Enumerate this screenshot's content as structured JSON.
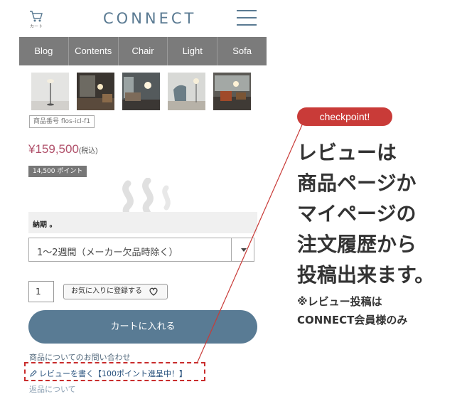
{
  "header": {
    "cart_label": "カート",
    "logo": "CONNECT",
    "cart_icon": "cart-icon",
    "menu_icon": "hamburger-menu-icon"
  },
  "nav": {
    "items": [
      {
        "label": "Blog"
      },
      {
        "label": "Contents"
      },
      {
        "label": "Chair"
      },
      {
        "label": "Light"
      },
      {
        "label": "Sofa"
      }
    ]
  },
  "product": {
    "sku": "商品番号 flos-icl-f1",
    "price": "¥159,500",
    "price_tax": "(税込)",
    "points": "14,500 ポイント",
    "period_label": "納期 。",
    "period_selected": "1〜2週間（メーカー欠品時除く）",
    "qty": "1",
    "favorite_label": "お気に入りに登録する",
    "cart_button": "カートに入れる"
  },
  "links": {
    "inquiry": "商品についてのお問い合わせ",
    "review": "レビューを書く【100ポイント進呈中！】",
    "returns": "返品について"
  },
  "callout": {
    "badge": "checkpoint!",
    "lines": [
      "レビューは",
      "商品ページか",
      "マイページの",
      "注文履歴から",
      "投稿出来ます。"
    ],
    "note_lines": [
      "※レビュー投稿は",
      "CONNECT会員様のみ"
    ],
    "color": "#c93b38"
  },
  "colors": {
    "accent": "#597b94",
    "nav_bg": "#7b7b7b",
    "price": "#b0506a",
    "highlight": "#c92c2c"
  }
}
